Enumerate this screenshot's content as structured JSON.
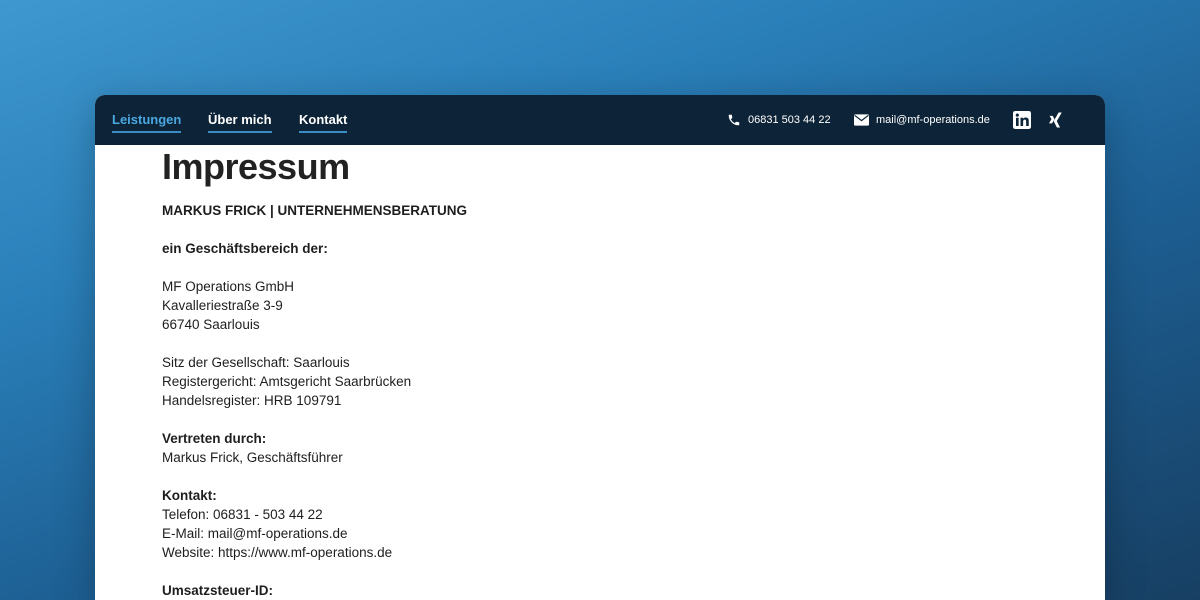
{
  "nav": {
    "items": [
      {
        "label": "Leistungen",
        "active": true
      },
      {
        "label": "Über mich",
        "active": false
      },
      {
        "label": "Kontakt",
        "active": false
      }
    ]
  },
  "contact": {
    "phone": "06831 503 44 22",
    "email": "mail@mf-operations.de"
  },
  "social": {
    "linkedin_icon": "linkedin-icon",
    "xing_icon": "xing-icon"
  },
  "colors": {
    "nav_bg": "#0d2438",
    "accent": "#3a8ec5",
    "active_link": "#4aa7e0"
  },
  "page": {
    "title": "Impressum",
    "company_heading": "MARKUS FRICK | UNTERNEHMENSBERATUNG",
    "division_heading": "ein Geschäftsbereich der:",
    "address": [
      "MF Operations GmbH",
      "Kavalleriestraße 3-9",
      "66740 Saarlouis"
    ],
    "registry": [
      "Sitz der Gesellschaft: Saarlouis",
      "Registergericht: Amtsgericht Saarbrücken",
      "Handelsregister: HRB 109791"
    ],
    "represented_heading": "Vertreten durch:",
    "represented_by": "Markus Frick, Geschäftsführer",
    "contact_heading": "Kontakt:",
    "contact_lines": [
      "Telefon: 06831 - 503 44 22",
      "E-Mail: mail@mf-operations.de",
      "Website: https://www.mf-operations.de"
    ],
    "vat_heading": "Umsatzsteuer-ID:"
  }
}
